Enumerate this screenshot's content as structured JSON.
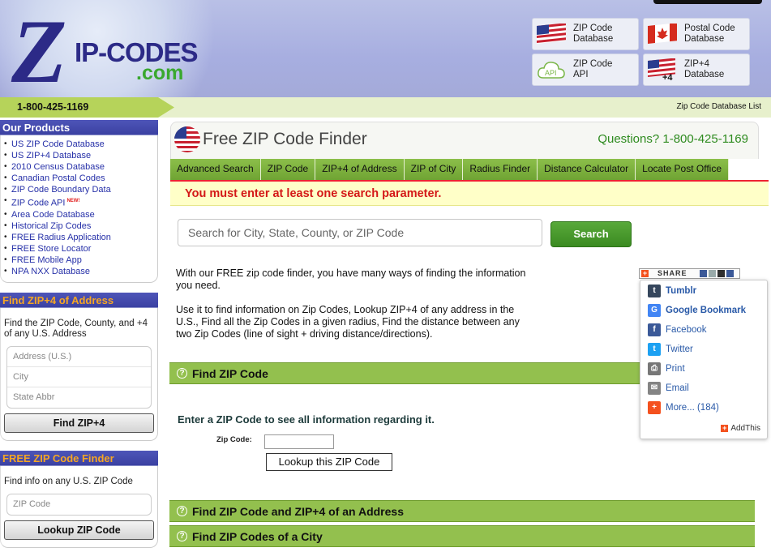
{
  "header": {
    "logo_z": "Z",
    "logo_text": "IP-CODES",
    "logo_com": ".com",
    "buttons": [
      {
        "label": "ZIP Code\nDatabase",
        "icon": "us-flag-icon"
      },
      {
        "label": "Postal Code\nDatabase",
        "icon": "canada-flag-icon"
      },
      {
        "label": "ZIP Code\nAPI",
        "icon": "api-cloud-icon",
        "icon_text": "API"
      },
      {
        "label": "ZIP+4\nDatabase",
        "icon": "us-flag-plus4-icon",
        "icon_text": "+4"
      }
    ]
  },
  "phonebar": {
    "phone": "1-800-425-1169",
    "link": "Zip Code Database List"
  },
  "sidebar": {
    "products": {
      "title": "Our Products",
      "items": [
        {
          "label": "US ZIP Code Database"
        },
        {
          "label": "US ZIP+4 Database"
        },
        {
          "label": "2010 Census Database"
        },
        {
          "label": "Canadian Postal Codes"
        },
        {
          "label": "ZIP Code Boundary Data"
        },
        {
          "label": "ZIP Code API",
          "badge": "NEW!"
        },
        {
          "label": "Area Code Database"
        },
        {
          "label": "Historical Zip Codes"
        },
        {
          "label": "FREE Radius Application"
        },
        {
          "label": "FREE Store Locator"
        },
        {
          "label": "FREE Mobile App"
        },
        {
          "label": "NPA NXX Database"
        }
      ]
    },
    "zip4": {
      "title": "Find ZIP+4 of Address",
      "desc": "Find the ZIP Code, County, and +4 of any U.S. Address",
      "fields": [
        "Address (U.S.)",
        "City",
        "State Abbr"
      ],
      "button": "Find ZIP+4"
    },
    "finder": {
      "title": "FREE ZIP Code Finder",
      "desc": "Find info on any U.S. ZIP Code",
      "field": "ZIP Code",
      "button": "Lookup ZIP Code"
    }
  },
  "main": {
    "title": "Free ZIP Code Finder",
    "questions": "Questions? 1-800-425-1169",
    "tabs": [
      "Advanced Search",
      "ZIP Code",
      "ZIP+4 of Address",
      "ZIP of City",
      "Radius Finder",
      "Distance Calculator",
      "Locate Post Office"
    ],
    "error": "You must enter at least one search parameter.",
    "search": {
      "placeholder": "Search for City, State, County, or ZIP Code",
      "button": "Search"
    },
    "intro1": "With our FREE zip code finder, you have many ways of finding the information you need.",
    "intro2": "Use it to find information on Zip Codes, Lookup ZIP+4 of any address in the U.S., Find all the Zip Codes in a given radius, Find the distance between any two Zip Codes (line of sight + driving distance/directions).",
    "sections": [
      "Find ZIP Code",
      "Find ZIP Code and ZIP+4 of an Address",
      "Find ZIP Codes of a City"
    ],
    "enter_zip": "Enter a ZIP Code to see all information regarding it.",
    "zip_label": "Zip Code:",
    "zip_value": "",
    "lookup_button": "Lookup this ZIP Code"
  },
  "share": {
    "button": "SHARE",
    "items": [
      {
        "label": "Tumblr",
        "icon": "tumblr-icon",
        "glyph": "t",
        "color": "#35465c",
        "bold": true
      },
      {
        "label": "Google Bookmark",
        "icon": "google-icon",
        "glyph": "G",
        "color": "#4285f4",
        "bold": true
      },
      {
        "label": "Facebook",
        "icon": "facebook-icon",
        "glyph": "f",
        "color": "#3b5998",
        "bold": false
      },
      {
        "label": "Twitter",
        "icon": "twitter-icon",
        "glyph": "t",
        "color": "#1da1f2",
        "bold": false
      },
      {
        "label": "Print",
        "icon": "print-icon",
        "glyph": "⎙",
        "color": "#777777",
        "bold": false
      },
      {
        "label": "Email",
        "icon": "email-icon",
        "glyph": "✉",
        "color": "#848484",
        "bold": false
      },
      {
        "label": "More... (184)",
        "icon": "more-plus-icon",
        "glyph": "+",
        "color": "#f4511e",
        "bold": false
      }
    ],
    "brand": "AddThis"
  },
  "colors": {
    "brand_blue": "#2c2a87",
    "accent_green": "#93c04e",
    "error_red": "#d41818"
  }
}
